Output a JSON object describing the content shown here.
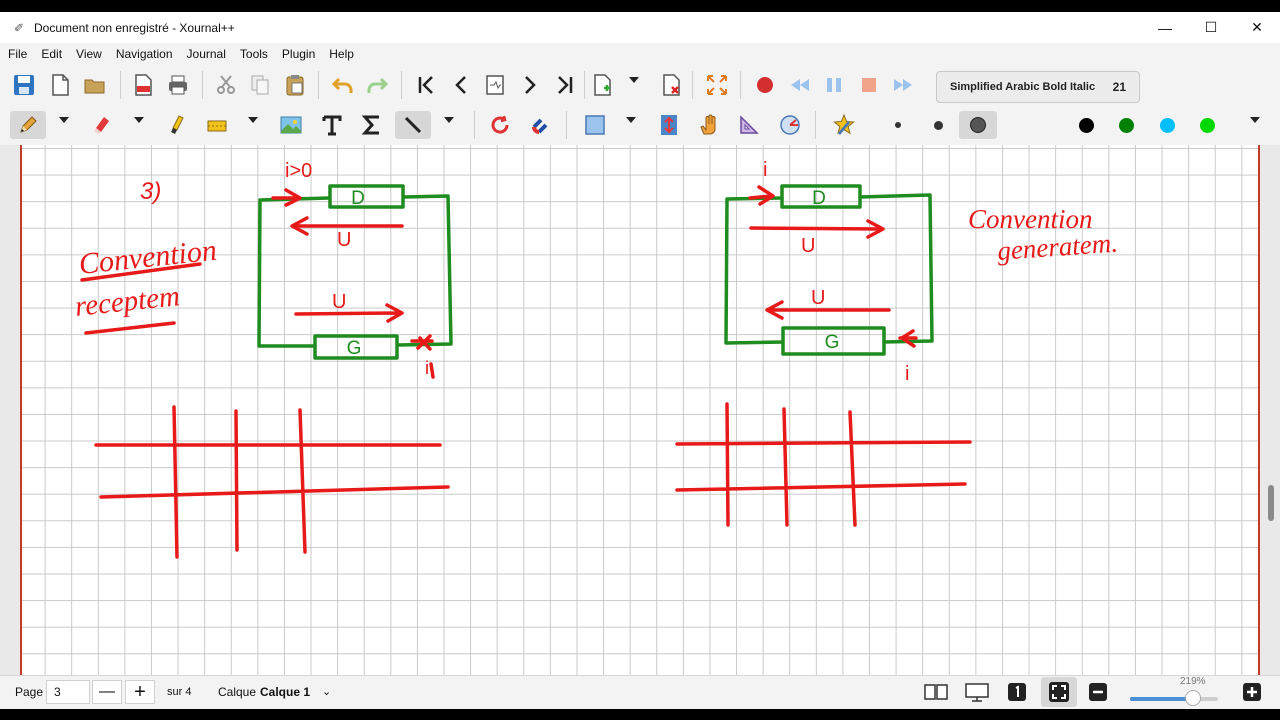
{
  "window": {
    "title": "Document non enregistré - Xournal++",
    "app_icon": "xournal-icon",
    "controls": {
      "minimize": "—",
      "maximize": "☐",
      "close": "✕"
    }
  },
  "menu": {
    "items": [
      "File",
      "Edit",
      "View",
      "Navigation",
      "Journal",
      "Tools",
      "Plugin",
      "Help"
    ]
  },
  "toolbar": {
    "font_name": "Simplified Arabic Bold Italic",
    "font_size": "21",
    "colors": {
      "black": "#000000",
      "green": "#008000",
      "cyan": "#00bfff",
      "lime": "#00d800",
      "red": "#e81919",
      "purple": "#8e44ad"
    }
  },
  "status": {
    "page_label": "Page",
    "page_value": "3",
    "page_total": "sur 4",
    "layer_label": "Calque",
    "layer_value": "Calque 1",
    "layer_dropdown": "⌄",
    "zoom": "219%",
    "zoom_fraction": 0.72,
    "minus": "—",
    "plus": "+"
  },
  "handwriting": {
    "left": {
      "number": "3)",
      "current": "i>0",
      "convention": [
        "Convention",
        "receptem"
      ],
      "dipole_top": "D",
      "dipole_bottom": "G",
      "tension_top": "U",
      "tension_bottom": "U",
      "current_bottom": "i"
    },
    "right": {
      "current_top": "i",
      "convention": [
        "Convention",
        "generatem."
      ],
      "dipole_top": "D",
      "dipole_bottom": "G",
      "tension_top": "U",
      "tension_bottom": "U",
      "current_bottom": "i"
    }
  }
}
